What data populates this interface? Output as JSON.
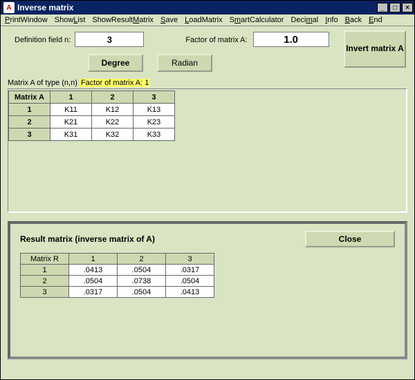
{
  "window": {
    "title": "Inverse matrix",
    "icon_text": "A"
  },
  "menu": {
    "items": [
      "PrintWindow",
      "ShowList",
      "ShowResultMatrix",
      "Save",
      "LoadMatrix",
      "SmartCalculator",
      "Decimal",
      "Info",
      "Back",
      "End"
    ],
    "underline_index": [
      0,
      4,
      10,
      0,
      0,
      1,
      4,
      0,
      0,
      0
    ]
  },
  "controls": {
    "definition_label": "Definition field n:",
    "definition_value": "3",
    "factor_label": "Factor of matrix A:",
    "factor_value": "1.0",
    "invert_button": "Invert matrix A",
    "degree_button": "Degree",
    "radian_button": "Radian"
  },
  "matrixA": {
    "label_prefix": "Matrix A of type (n,n)",
    "label_highlight": "Factor of matrix A: 1",
    "corner": "Matrix A",
    "col_headers": [
      "1",
      "2",
      "3"
    ],
    "row_headers": [
      "1",
      "2",
      "3"
    ],
    "rows": [
      [
        "K11",
        "K12",
        "K13"
      ],
      [
        "K21",
        "K22",
        "K23"
      ],
      [
        "K31",
        "K32",
        "K33"
      ]
    ]
  },
  "result": {
    "title": "Result matrix (inverse matrix of A)",
    "close_button": "Close",
    "corner": "Matrix R",
    "col_headers": [
      "1",
      "2",
      "3"
    ],
    "row_headers": [
      "1",
      "2",
      "3"
    ],
    "rows": [
      [
        ".0413",
        ".0504",
        ".0317"
      ],
      [
        ".0504",
        ".0738",
        ".0504"
      ],
      [
        ".0317",
        ".0504",
        ".0413"
      ]
    ]
  }
}
